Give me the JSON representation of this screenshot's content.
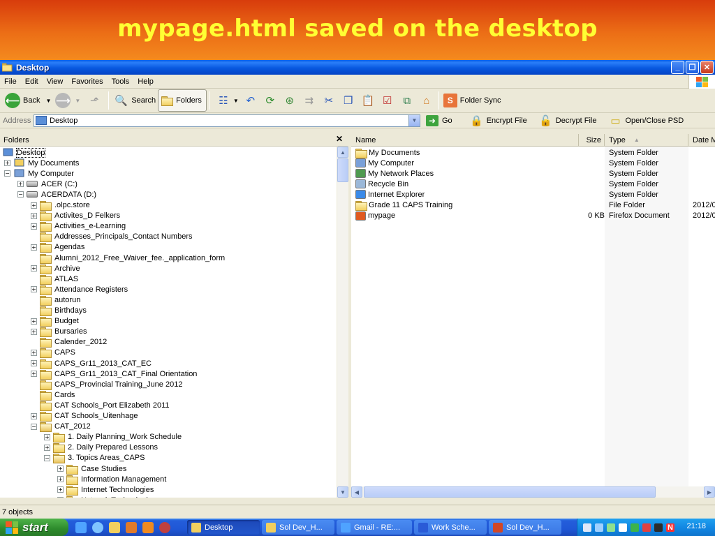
{
  "slide": {
    "title": "mypage.html saved on the desktop"
  },
  "window": {
    "title": "Desktop"
  },
  "menu": [
    "File",
    "Edit",
    "View",
    "Favorites",
    "Tools",
    "Help"
  ],
  "toolbar": {
    "back_label": "Back",
    "search_label": "Search",
    "folders_label": "Folders",
    "folder_sync_label": "Folder Sync"
  },
  "address": {
    "label": "Address",
    "value": "Desktop",
    "go_label": "Go",
    "encrypt_label": "Encrypt File",
    "decrypt_label": "Decrypt File",
    "psd_label": "Open/Close PSD"
  },
  "folders_pane": {
    "title": "Folders",
    "tree": [
      {
        "label": "Desktop",
        "level": 0,
        "toggle": "none",
        "icon": "desktop-icon"
      },
      {
        "label": "My Documents",
        "level": 1,
        "toggle": "plus",
        "icon": "my-documents-icon"
      },
      {
        "label": "My Computer",
        "level": 1,
        "toggle": "minus",
        "icon": "my-computer-icon"
      },
      {
        "label": "ACER (C:)",
        "level": 2,
        "toggle": "plus",
        "icon": "drive-icon"
      },
      {
        "label": "ACERDATA (D:)",
        "level": 2,
        "toggle": "minus",
        "icon": "drive-icon"
      },
      {
        "label": ".olpc.store",
        "level": 3,
        "toggle": "plus",
        "icon": "folder-icon"
      },
      {
        "label": "Activites_D Felkers",
        "level": 3,
        "toggle": "plus",
        "icon": "folder-icon"
      },
      {
        "label": "Activities_e-Learning",
        "level": 3,
        "toggle": "plus",
        "icon": "folder-icon"
      },
      {
        "label": "Addresses_Principals_Contact Numbers",
        "level": 3,
        "toggle": "none",
        "icon": "folder-icon"
      },
      {
        "label": "Agendas",
        "level": 3,
        "toggle": "plus",
        "icon": "folder-icon"
      },
      {
        "label": "Alumni_2012_Free_Waiver_fee._application_form",
        "level": 3,
        "toggle": "none",
        "icon": "folder-icon"
      },
      {
        "label": "Archive",
        "level": 3,
        "toggle": "plus",
        "icon": "folder-icon"
      },
      {
        "label": "ATLAS",
        "level": 3,
        "toggle": "none",
        "icon": "folder-icon"
      },
      {
        "label": "Attendance Registers",
        "level": 3,
        "toggle": "plus",
        "icon": "folder-icon"
      },
      {
        "label": "autorun",
        "level": 3,
        "toggle": "none",
        "icon": "folder-icon"
      },
      {
        "label": "Birthdays",
        "level": 3,
        "toggle": "none",
        "icon": "folder-icon"
      },
      {
        "label": "Budget",
        "level": 3,
        "toggle": "plus",
        "icon": "folder-icon"
      },
      {
        "label": "Bursaries",
        "level": 3,
        "toggle": "plus",
        "icon": "folder-icon"
      },
      {
        "label": "Calender_2012",
        "level": 3,
        "toggle": "none",
        "icon": "folder-icon"
      },
      {
        "label": "CAPS",
        "level": 3,
        "toggle": "plus",
        "icon": "folder-icon"
      },
      {
        "label": "CAPS_Gr11_2013_CAT_EC",
        "level": 3,
        "toggle": "plus",
        "icon": "folder-icon"
      },
      {
        "label": "CAPS_Gr11_2013_CAT_Final Orientation",
        "level": 3,
        "toggle": "plus",
        "icon": "folder-icon"
      },
      {
        "label": "CAPS_Provincial Training_June 2012",
        "level": 3,
        "toggle": "none",
        "icon": "folder-icon"
      },
      {
        "label": "Cards",
        "level": 3,
        "toggle": "none",
        "icon": "folder-icon"
      },
      {
        "label": "CAT Schools_Port Elizabeth 2011",
        "level": 3,
        "toggle": "none",
        "icon": "folder-icon"
      },
      {
        "label": "CAT Schools_Uitenhage",
        "level": 3,
        "toggle": "plus",
        "icon": "folder-icon"
      },
      {
        "label": "CAT_2012",
        "level": 3,
        "toggle": "minus",
        "icon": "folder-open-icon"
      },
      {
        "label": "1. Daily Planning_Work Schedule",
        "level": 4,
        "toggle": "plus",
        "icon": "folder-icon"
      },
      {
        "label": "2. Daily Prepared Lessons",
        "level": 4,
        "toggle": "plus",
        "icon": "folder-icon"
      },
      {
        "label": "3. Topics Areas_CAPS",
        "level": 4,
        "toggle": "minus",
        "icon": "folder-open-icon"
      },
      {
        "label": "Case Studies",
        "level": 5,
        "toggle": "plus",
        "icon": "folder-icon"
      },
      {
        "label": "Information Management",
        "level": 5,
        "toggle": "plus",
        "icon": "folder-icon"
      },
      {
        "label": "Internet Technologies",
        "level": 5,
        "toggle": "plus",
        "icon": "folder-icon"
      },
      {
        "label": "Network Technologies",
        "level": 5,
        "toggle": "plus",
        "icon": "folder-icon"
      }
    ]
  },
  "file_list": {
    "columns": {
      "name": "Name",
      "size": "Size",
      "type": "Type",
      "date": "Date M"
    },
    "rows": [
      {
        "name": "My Documents",
        "size": "",
        "type": "System Folder",
        "date": "",
        "icon": "my-documents-icon"
      },
      {
        "name": "My Computer",
        "size": "",
        "type": "System Folder",
        "date": "",
        "icon": "my-computer-icon"
      },
      {
        "name": "My Network Places",
        "size": "",
        "type": "System Folder",
        "date": "",
        "icon": "network-places-icon"
      },
      {
        "name": "Recycle Bin",
        "size": "",
        "type": "System Folder",
        "date": "",
        "icon": "recycle-bin-icon"
      },
      {
        "name": "Internet Explorer",
        "size": "",
        "type": "System Folder",
        "date": "",
        "icon": "internet-explorer-icon"
      },
      {
        "name": "Grade 11 CAPS Training",
        "size": "",
        "type": "File Folder",
        "date": "2012/0",
        "icon": "folder-icon"
      },
      {
        "name": "mypage",
        "size": "0 KB",
        "type": "Firefox Document",
        "date": "2012/0",
        "icon": "firefox-document-icon"
      }
    ]
  },
  "status": {
    "text": "7 objects"
  },
  "taskbar": {
    "start_label": "start",
    "tasks": [
      {
        "label": "Desktop",
        "active": true,
        "icon": "folder-icon",
        "color": "#f2cf5f"
      },
      {
        "label": "Sol Dev_H...",
        "active": false,
        "icon": "folder-icon",
        "color": "#f2cf5f"
      },
      {
        "label": "Gmail - RE:...",
        "active": false,
        "icon": "internet-explorer-icon",
        "color": "#4fa3ff"
      },
      {
        "label": "Work Sche...",
        "active": false,
        "icon": "word-icon",
        "color": "#2a5bd7"
      },
      {
        "label": "Sol Dev_H...",
        "active": false,
        "icon": "powerpoint-icon",
        "color": "#d24726"
      }
    ],
    "clock": "21:18"
  }
}
